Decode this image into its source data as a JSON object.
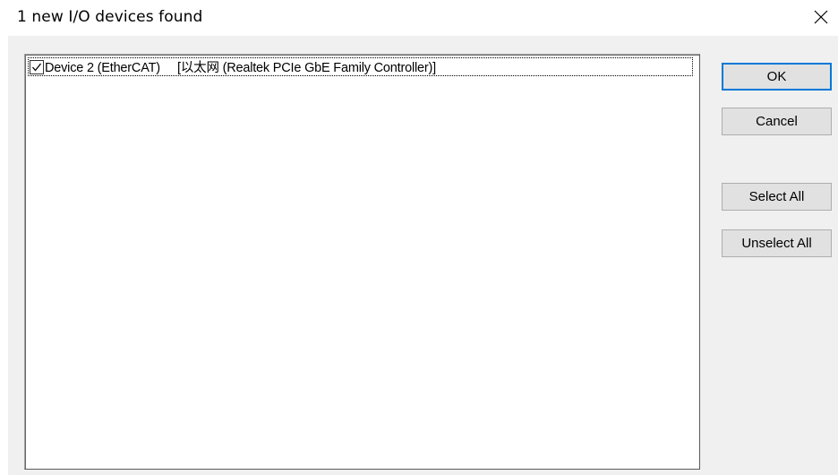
{
  "window": {
    "title": "1 new I/O devices found",
    "close_icon": "close-icon"
  },
  "devices": [
    {
      "checked": true,
      "label": "Device 2 (EtherCAT)     [以太网 (Realtek PCIe GbE Family Controller)]"
    }
  ],
  "buttons": {
    "ok": "OK",
    "cancel": "Cancel",
    "select_all": "Select All",
    "unselect_all": "Unselect All"
  },
  "colors": {
    "client_background": "#f0f0f0",
    "button_face": "#e1e1e1",
    "default_button_border": "#0078d7"
  }
}
